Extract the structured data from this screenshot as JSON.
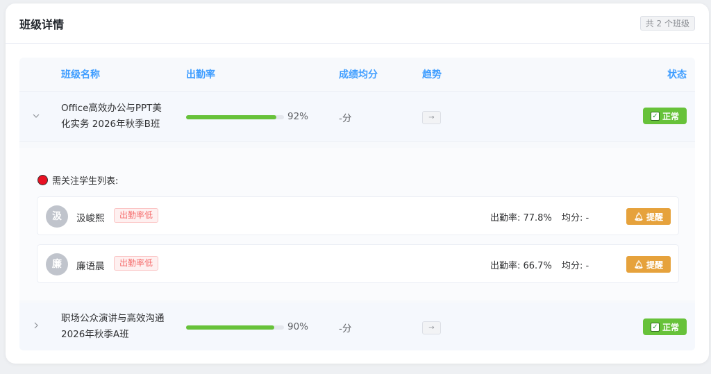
{
  "header": {
    "title": "班级详情",
    "count_badge": "共 2 个班级"
  },
  "table": {
    "columns": [
      "班级名称",
      "出勤率",
      "成绩均分",
      "趋势",
      "状态"
    ],
    "rows": [
      {
        "name_line1": "Office高效办公与PPT美",
        "name_line2": "化实务 2026年秋季B班",
        "attendance": 92,
        "attendance_label": "92%",
        "score": "-分",
        "trend_icon": "→",
        "status": "正常",
        "expanded": true
      },
      {
        "name_line1": "职场公众演讲与高效沟通",
        "name_line2": "2026年秋季A班",
        "attendance": 90,
        "attendance_label": "90%",
        "score": "-分",
        "trend_icon": "→",
        "status": "正常",
        "expanded": false
      }
    ]
  },
  "attention": {
    "title": "需关注学生列表:",
    "students": [
      {
        "avatar": "汲",
        "name": "汲峻熙",
        "tag": "出勤率低",
        "rate": "出勤率: 77.8%",
        "avg": "均分: -",
        "remind": "提醒"
      },
      {
        "avatar": "廉",
        "name": "廉语晨",
        "tag": "出勤率低",
        "rate": "出勤率: 66.7%",
        "avg": "均分: -",
        "remind": "提醒"
      }
    ]
  },
  "colors": {
    "accent": "#409eff",
    "success": "#67c23a",
    "warning": "#e6a23c",
    "danger": "#f56c6c"
  },
  "icons": {
    "expand": "chevron-down-icon",
    "check": "check-icon",
    "bell": "bell-icon",
    "trend": "arrow-right-icon"
  }
}
